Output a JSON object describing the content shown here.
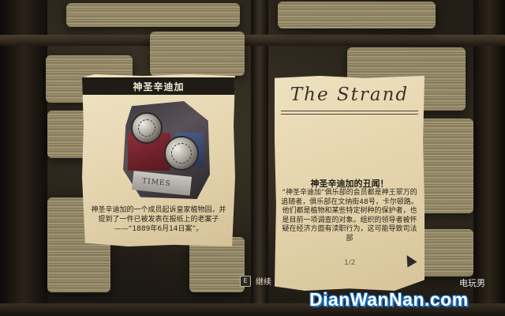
{
  "left_card": {
    "title": "神圣辛迪加",
    "image_caption": "TIMES",
    "text": "神圣辛迪加的一个成员起诉皇家植物园，并提到了一件已被发表在报纸上的老案子——“1889年6月14日案”。"
  },
  "right_card": {
    "masthead": "The Strand",
    "headline": "神圣辛迪加的丑闻！",
    "body": "“神圣辛迪加”俱乐部的会员都是神王翠万的追随者，俱乐部在文纳街48号，卡尔顿路。他们都是植物和某些特定树种的保护者，也是目前一项调查的对象。组织的领导者被怀疑在经济方面有渎职行为，这可能导致司法部",
    "page": "1/2"
  },
  "prompt": {
    "key": "E",
    "label": "继续"
  },
  "watermark": {
    "cn": "电玩男",
    "en": "DianWanNan.com"
  }
}
